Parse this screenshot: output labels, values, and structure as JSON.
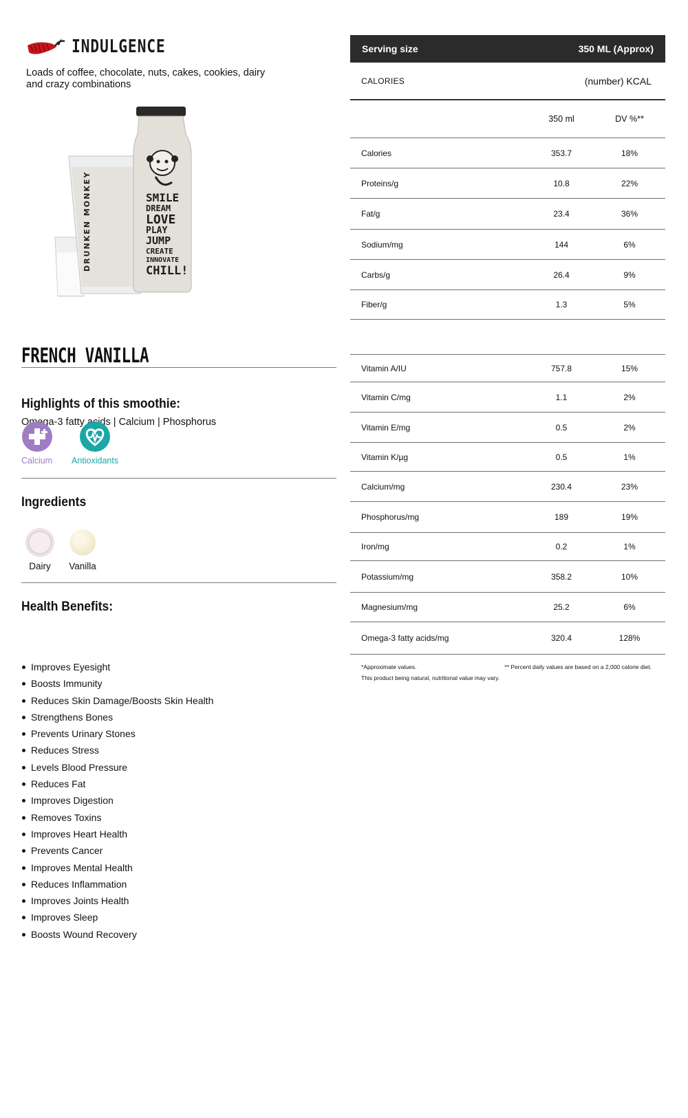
{
  "category": {
    "name": "INDULGENCE",
    "description": "Loads of coffee, chocolate, nuts, cakes, cookies, dairy and crazy combinations"
  },
  "product": {
    "title": "FRENCH VANILLA",
    "bottle_brand": "DRUNKEN MONKEY",
    "bottle_words": [
      "SMILE",
      "DREAM",
      "LOVE",
      "PLAY laugh",
      "JUMP kiss",
      "CREATE",
      "INNOVATE",
      "CHILL!"
    ]
  },
  "highlights": {
    "title": "Highlights of this smoothie:",
    "text": "Omega-3 fatty acids | Calcium | Phosphorus",
    "badges": [
      {
        "label": "Calcium",
        "icon": "calcium-plus-icon",
        "color": "#a07cc5"
      },
      {
        "label": "Antioxidants",
        "icon": "heart-pulse-icon",
        "color": "#1aa7a5"
      }
    ]
  },
  "ingredients": {
    "title": "Ingredients",
    "items": [
      {
        "label": "Dairy",
        "icon": "dairy-icon"
      },
      {
        "label": "Vanilla",
        "icon": "vanilla-icon"
      }
    ]
  },
  "benefits": {
    "title": "Health Benefits:",
    "items": [
      "Improves Eyesight",
      "Boosts Immunity",
      "Reduces Skin Damage/Boosts Skin Health",
      "Strengthens Bones",
      "Prevents Urinary Stones",
      "Reduces Stress",
      "Levels Blood Pressure",
      "Reduces Fat",
      "Improves Digestion",
      "Removes Toxins",
      "Improves Heart Health",
      "Prevents Cancer",
      "Improves Mental Health",
      "Reduces Inflammation",
      "Improves Joints Health",
      "Improves Sleep",
      "Boosts Wound Recovery"
    ]
  },
  "nutrition": {
    "serving_label": "Serving size",
    "serving_value": "350 ML (Approx)",
    "calories_label": "CALORIES",
    "calories_value": "(number) KCAL",
    "col_amount": "350 ml",
    "col_dv": "DV %**",
    "macros": [
      {
        "name": "Calories",
        "amount": "353.7",
        "dv": "18%"
      },
      {
        "name": "Proteins/g",
        "amount": "10.8",
        "dv": "22%"
      },
      {
        "name": "Fat/g",
        "amount": "23.4",
        "dv": "36%"
      },
      {
        "name": "Sodium/mg",
        "amount": "144",
        "dv": "6%"
      },
      {
        "name": "Carbs/g",
        "amount": "26.4",
        "dv": "9%"
      },
      {
        "name": "Fiber/g",
        "amount": "1.3",
        "dv": "5%"
      }
    ],
    "micros": [
      {
        "name": "Vitamin A/IU",
        "amount": "757.8",
        "dv": "15%"
      },
      {
        "name": "Vitamin C/mg",
        "amount": "1.1",
        "dv": "2%"
      },
      {
        "name": "Vitamin E/mg",
        "amount": "0.5",
        "dv": "2%"
      },
      {
        "name": "Vitamin K/µg",
        "amount": "0.5",
        "dv": "1%"
      },
      {
        "name": "Calcium/mg",
        "amount": "230.4",
        "dv": "23%"
      },
      {
        "name": "Phosphorus/mg",
        "amount": "189",
        "dv": "19%"
      },
      {
        "name": "Iron/mg",
        "amount": "0.2",
        "dv": "1%"
      },
      {
        "name": "Potassium/mg",
        "amount": "358.2",
        "dv": "10%"
      },
      {
        "name": "Magnesium/mg",
        "amount": "25.2",
        "dv": "6%"
      },
      {
        "name": "Omega-3 fatty acids/mg",
        "amount": "320.4",
        "dv": "128%"
      }
    ],
    "footnote_left_1": "*Approximate values.",
    "footnote_left_2": "This product being natural, nutritional value may vary.",
    "footnote_right": "** Percent daily values are based on a 2,000 calorie diet."
  }
}
